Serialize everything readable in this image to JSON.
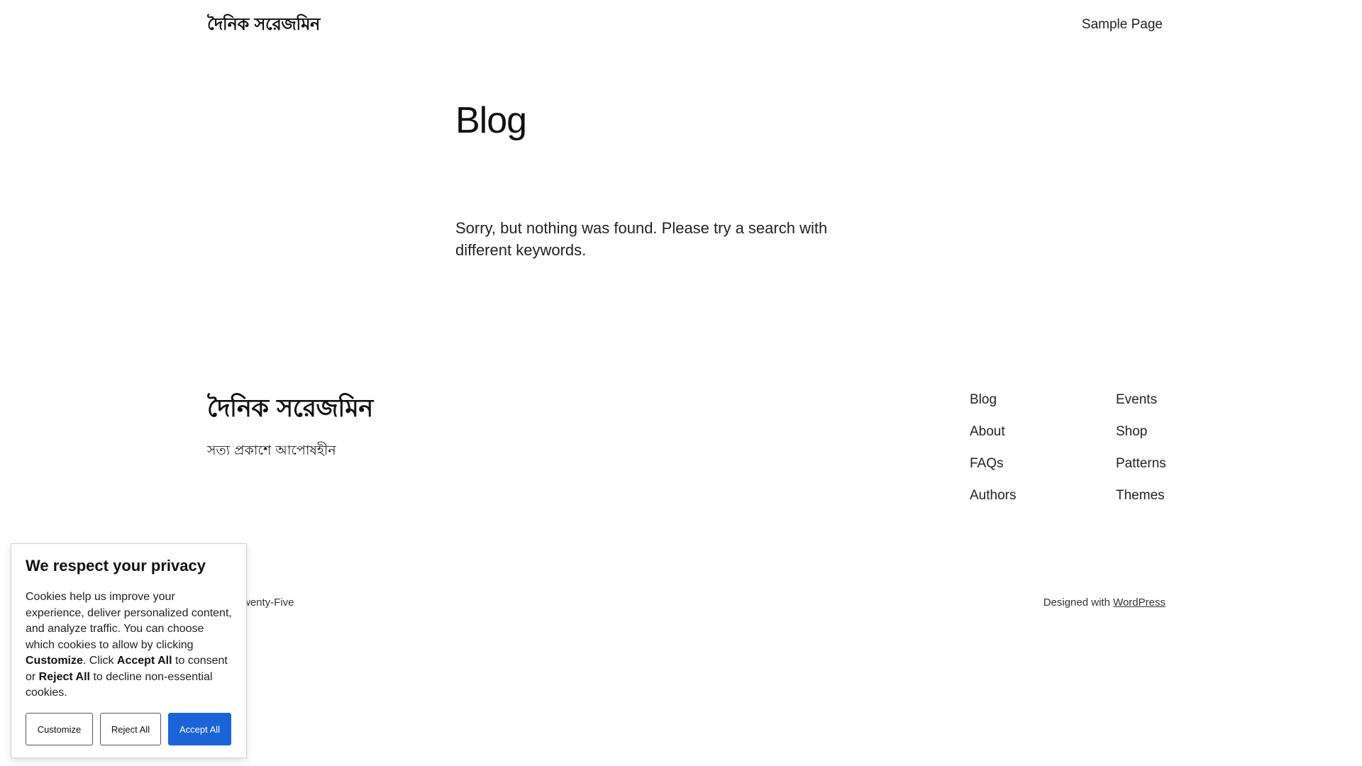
{
  "header": {
    "site_title": "দৈনিক সরেজমিন",
    "nav_sample_page": "Sample Page"
  },
  "main": {
    "page_title": "Blog",
    "not_found_message": "Sorry, but nothing was found. Please try a search with different keywords."
  },
  "footer": {
    "site_title": "দৈনিক সরেজমিন",
    "tagline": "সত্য প্রকাশে আপোষহীন",
    "nav_col1": [
      "Blog",
      "About",
      "FAQs",
      "Authors"
    ],
    "nav_col2": [
      "Events",
      "Shop",
      "Patterns",
      "Themes"
    ],
    "theme_credit_visible": "wenty-Five",
    "designed_with": "Designed with ",
    "wordpress_link": "WordPress"
  },
  "cookie_banner": {
    "title": "We respect your privacy",
    "text_1": "Cookies help us improve your experience, deliver personalized content, and analyze traffic. You can choose which cookies to allow by clicking ",
    "bold_customize": "Customize",
    "text_2": ". Click ",
    "bold_accept": "Accept All",
    "text_3": " to consent or ",
    "bold_reject": "Reject All",
    "text_4": " to decline non-essential cookies.",
    "btn_customize": "Customize",
    "btn_reject": "Reject All",
    "btn_accept": "Accept All",
    "accent_color": "#1a64d8"
  }
}
